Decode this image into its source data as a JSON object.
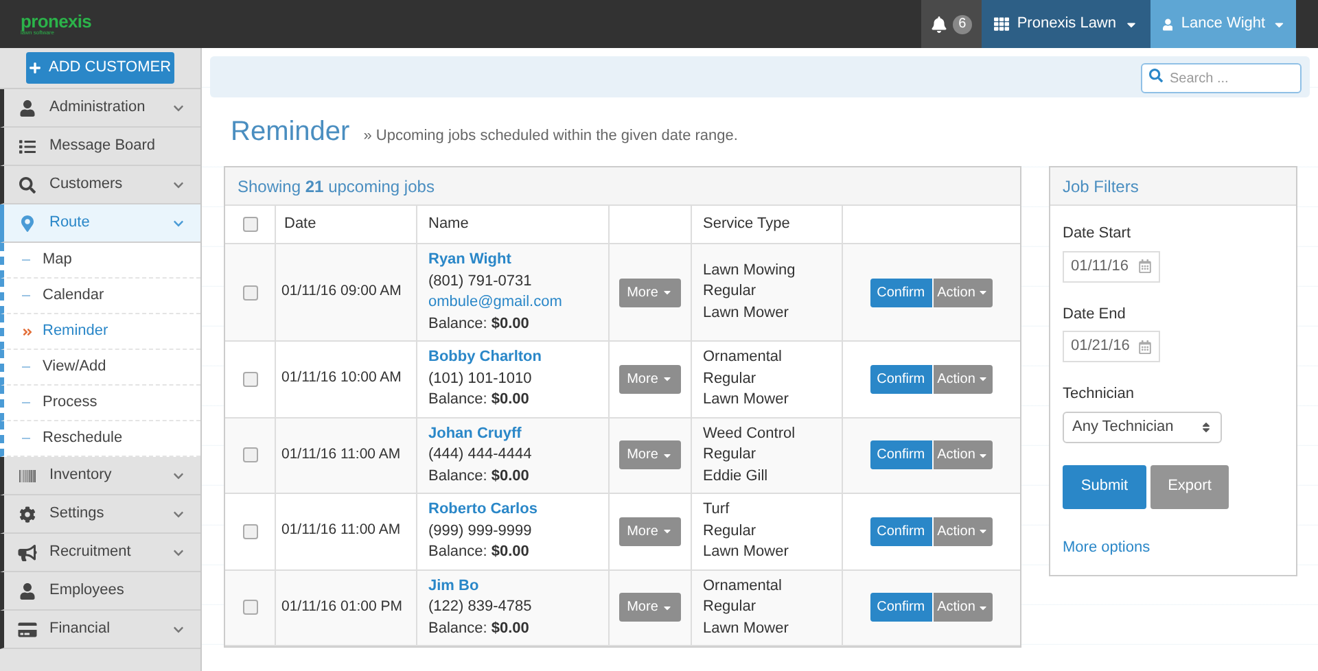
{
  "topbar": {
    "logo": "pronexis",
    "logo_subtitle": "lawn software",
    "notifications": "6",
    "company": "Pronexis Lawn",
    "user": "Lance Wight"
  },
  "sidebar": {
    "add_button": "ADD CUSTOMER",
    "items": [
      {
        "label": "Administration",
        "expandable": true,
        "selected": false
      },
      {
        "label": "Message Board",
        "expandable": false,
        "selected": false
      },
      {
        "label": "Customers",
        "expandable": true,
        "selected": false
      },
      {
        "label": "Route",
        "expandable": true,
        "selected": true,
        "children": [
          {
            "label": "Map",
            "selected": false
          },
          {
            "label": "Calendar",
            "selected": false
          },
          {
            "label": "Reminder",
            "selected": true
          },
          {
            "label": "View/Add",
            "selected": false
          },
          {
            "label": "Process",
            "selected": false
          },
          {
            "label": "Reschedule",
            "selected": false
          }
        ]
      },
      {
        "label": "Inventory",
        "expandable": true,
        "selected": false
      },
      {
        "label": "Settings",
        "expandable": true,
        "selected": false
      },
      {
        "label": "Recruitment",
        "expandable": true,
        "selected": false
      },
      {
        "label": "Employees",
        "expandable": false,
        "selected": false
      },
      {
        "label": "Financial",
        "expandable": true,
        "selected": false
      }
    ]
  },
  "search": {
    "placeholder": "Search ..."
  },
  "page": {
    "title": "Reminder",
    "subtitle": "» Upcoming jobs scheduled within the given date range."
  },
  "table": {
    "summary": "Showing **21** upcoming jobs",
    "header_checked": false,
    "columns": [
      "Date",
      "Name",
      "Service Type"
    ],
    "rows": [
      {
        "checked": false,
        "date": "01/11/16 09:00 AM",
        "name": "Ryan Wight",
        "phone": "(801) 791-0731",
        "email": "ombule@gmail.com",
        "balance": "Balance: **$0.00**",
        "more": "More",
        "service": [
          "Lawn Mowing",
          "Regular",
          "Lawn Mower"
        ],
        "confirm": "Confirm",
        "action": "Action"
      },
      {
        "checked": false,
        "date": "01/11/16 10:00 AM",
        "name": "Bobby Charlton",
        "phone": "(101) 101-1010",
        "balance": "Balance: **$0.00**",
        "more": "More",
        "service": [
          "Ornamental",
          "Regular",
          "Lawn Mower"
        ],
        "confirm": "Confirm",
        "action": "Action"
      },
      {
        "checked": false,
        "date": "01/11/16 11:00 AM",
        "name": "Johan Cruyff",
        "phone": "(444) 444-4444",
        "balance": "Balance: **$0.00**",
        "more": "More",
        "service": [
          "Weed Control",
          "Regular",
          "Eddie Gill"
        ],
        "confirm": "Confirm",
        "action": "Action"
      },
      {
        "checked": false,
        "date": "01/11/16 11:00 AM",
        "name": "Roberto Carlos",
        "phone": "(999) 999-9999",
        "balance": "Balance: **$0.00**",
        "more": "More",
        "service": [
          "Turf",
          "Regular",
          "Lawn Mower"
        ],
        "confirm": "Confirm",
        "action": "Action"
      },
      {
        "checked": false,
        "date": "01/11/16 01:00 PM",
        "name": "Jim Bo",
        "phone": "(122) 839-4785",
        "balance": "Balance: **$0.00**",
        "more": "More",
        "service": [
          "Ornamental",
          "Regular",
          "Lawn Mower"
        ],
        "confirm": "Confirm",
        "action": "Action"
      }
    ]
  },
  "filters": {
    "title": "Job Filters",
    "date_start_label": "Date Start",
    "date_start": "01/11/16",
    "date_end_label": "Date End",
    "date_end": "01/21/16",
    "technician_label": "Technician",
    "technician": "Any Technician",
    "submit": "Submit",
    "export": "Export",
    "more_options": "More options"
  }
}
